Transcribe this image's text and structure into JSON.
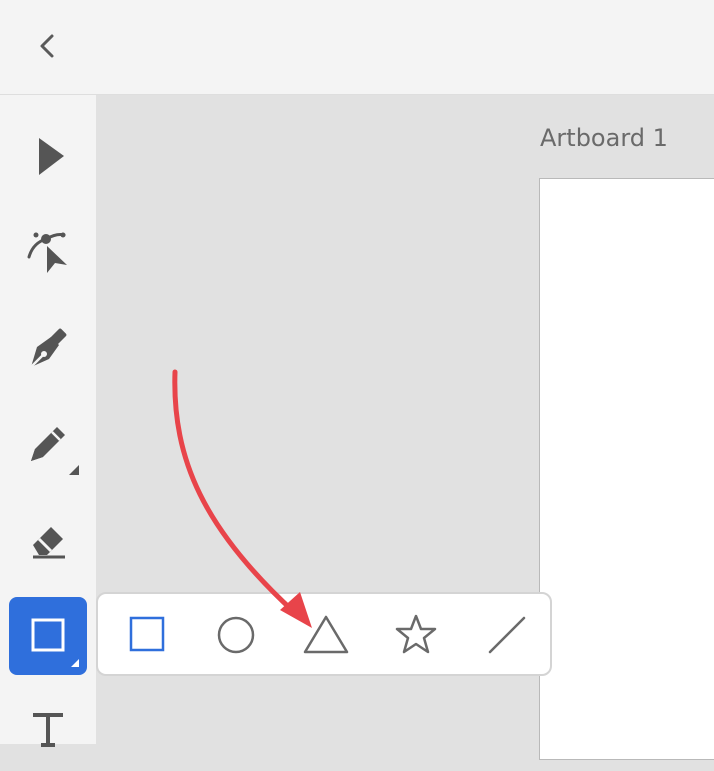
{
  "app": {
    "artboard_label": "Artboard 1",
    "accent_color": "#2f6fdc",
    "annotation_color": "#e8444a"
  },
  "topbar": {
    "back_icon": "chevron-left-icon"
  },
  "toolbar": {
    "tools": [
      {
        "name": "select-tool",
        "icon": "arrow-cursor-icon",
        "active": false
      },
      {
        "name": "direct-select-tool",
        "icon": "node-select-icon",
        "active": false
      },
      {
        "name": "pen-tool",
        "icon": "pen-nib-icon",
        "active": false
      },
      {
        "name": "pencil-tool",
        "icon": "pencil-icon",
        "active": false,
        "has_submenu": true
      },
      {
        "name": "eraser-tool",
        "icon": "eraser-icon",
        "active": false
      },
      {
        "name": "shape-tool",
        "icon": "rectangle-icon",
        "active": true,
        "has_submenu": true
      },
      {
        "name": "text-tool",
        "icon": "text-t-icon",
        "active": false
      }
    ]
  },
  "shape_flyout": {
    "options": [
      {
        "name": "rectangle",
        "icon": "rectangle-icon",
        "selected": true
      },
      {
        "name": "ellipse",
        "icon": "circle-icon",
        "selected": false
      },
      {
        "name": "triangle",
        "icon": "triangle-icon",
        "selected": false
      },
      {
        "name": "star",
        "icon": "star-icon",
        "selected": false
      },
      {
        "name": "line",
        "icon": "line-icon",
        "selected": false
      }
    ]
  }
}
